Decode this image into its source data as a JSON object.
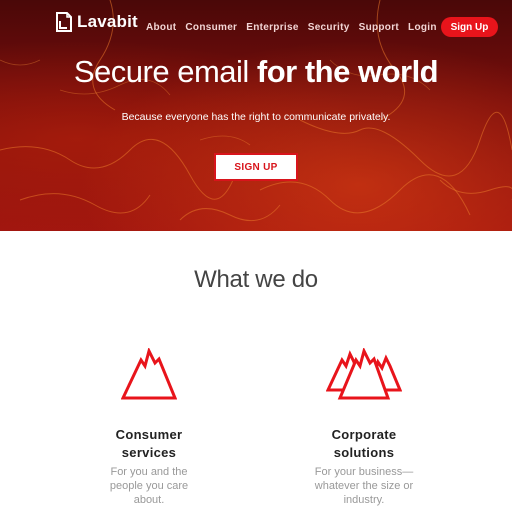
{
  "brand": {
    "name": "Lavabit"
  },
  "nav": {
    "items": [
      {
        "label": "About"
      },
      {
        "label": "Consumer"
      },
      {
        "label": "Enterprise"
      },
      {
        "label": "Security"
      },
      {
        "label": "Support"
      },
      {
        "label": "Login"
      }
    ],
    "signup_label": "Sign Up"
  },
  "hero": {
    "headline_light": "Secure email ",
    "headline_bold": "for the world",
    "tagline": "Because everyone has the right to communicate privately.",
    "cta_label": "SIGN UP"
  },
  "section": {
    "title": "What we do"
  },
  "features": [
    {
      "icon": "single-mountain-icon",
      "title_line1": "Consumer",
      "title_line2": "services",
      "desc_line1": "For you and the",
      "desc_line2": "people you care",
      "desc_line3": "about."
    },
    {
      "icon": "mountain-range-icon",
      "title_line1": "Corporate",
      "title_line2": "solutions",
      "desc_line1": "For your business—",
      "desc_line2": "whatever the size or",
      "desc_line3": "industry."
    }
  ],
  "colors": {
    "accent": "#e8141b",
    "hero_dark": "#4a0808",
    "hero_mid": "#a1160f"
  }
}
